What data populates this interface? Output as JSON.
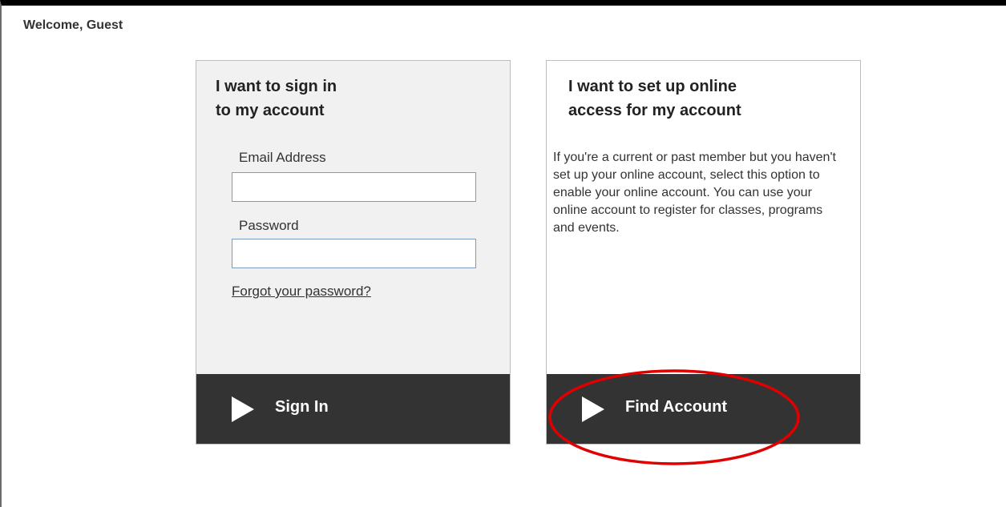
{
  "header": {
    "welcome_text": "Welcome, Guest"
  },
  "signin_card": {
    "title_line1": "I want to sign in",
    "title_line2": "to my account",
    "email_label": "Email Address",
    "email_value": "",
    "password_label": "Password",
    "password_value": "",
    "forgot_link": "Forgot your password?",
    "button_label": "Sign In",
    "button_icon": "play-icon"
  },
  "setup_card": {
    "title_line1": "I want to set up online",
    "title_line2": "access for my account",
    "description": "If you're a current or past member but you haven't set up your online account, select this option to enable your online account. You can use your online account to register for classes, programs and events.",
    "button_label": "Find Account",
    "button_icon": "play-icon"
  },
  "annotation": {
    "shape": "ellipse",
    "color": "#e00000",
    "target": "Find Account"
  },
  "colors": {
    "action_bar": "#333333",
    "signin_card_bg": "#f1f1f1",
    "input_border": "#7a9cbf"
  }
}
